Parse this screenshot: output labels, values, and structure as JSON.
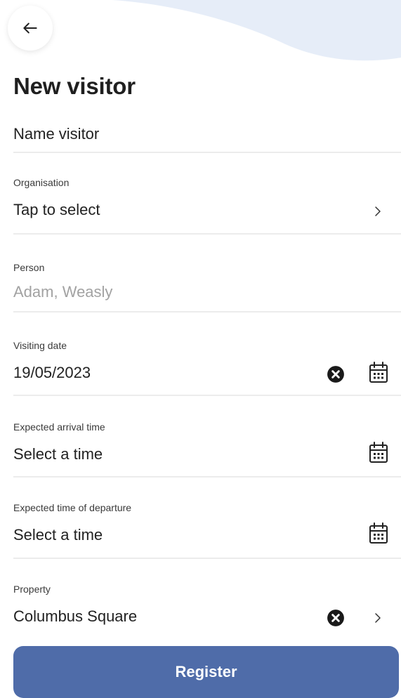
{
  "header": {
    "back_icon": "arrow-left-icon",
    "title": "New visitor"
  },
  "form": {
    "name": {
      "placeholder": "Name visitor"
    },
    "organisation": {
      "label": "Organisation",
      "value": "Tap to select"
    },
    "person": {
      "label": "Person",
      "value": "Adam, Weasly"
    },
    "visiting_date": {
      "label": "Visiting date",
      "value": "19/05/2023"
    },
    "arrival_time": {
      "label": "Expected arrival time",
      "value": "Select a time"
    },
    "departure_time": {
      "label": "Expected time of departure",
      "value": "Select a time"
    },
    "property": {
      "label": "Property",
      "value": "Columbus Square"
    }
  },
  "actions": {
    "register_label": "Register"
  },
  "colors": {
    "primary": "#4f6ca9",
    "wave": "#e6edf8",
    "divider": "#ececec",
    "muted_text": "#a2a2a2"
  }
}
